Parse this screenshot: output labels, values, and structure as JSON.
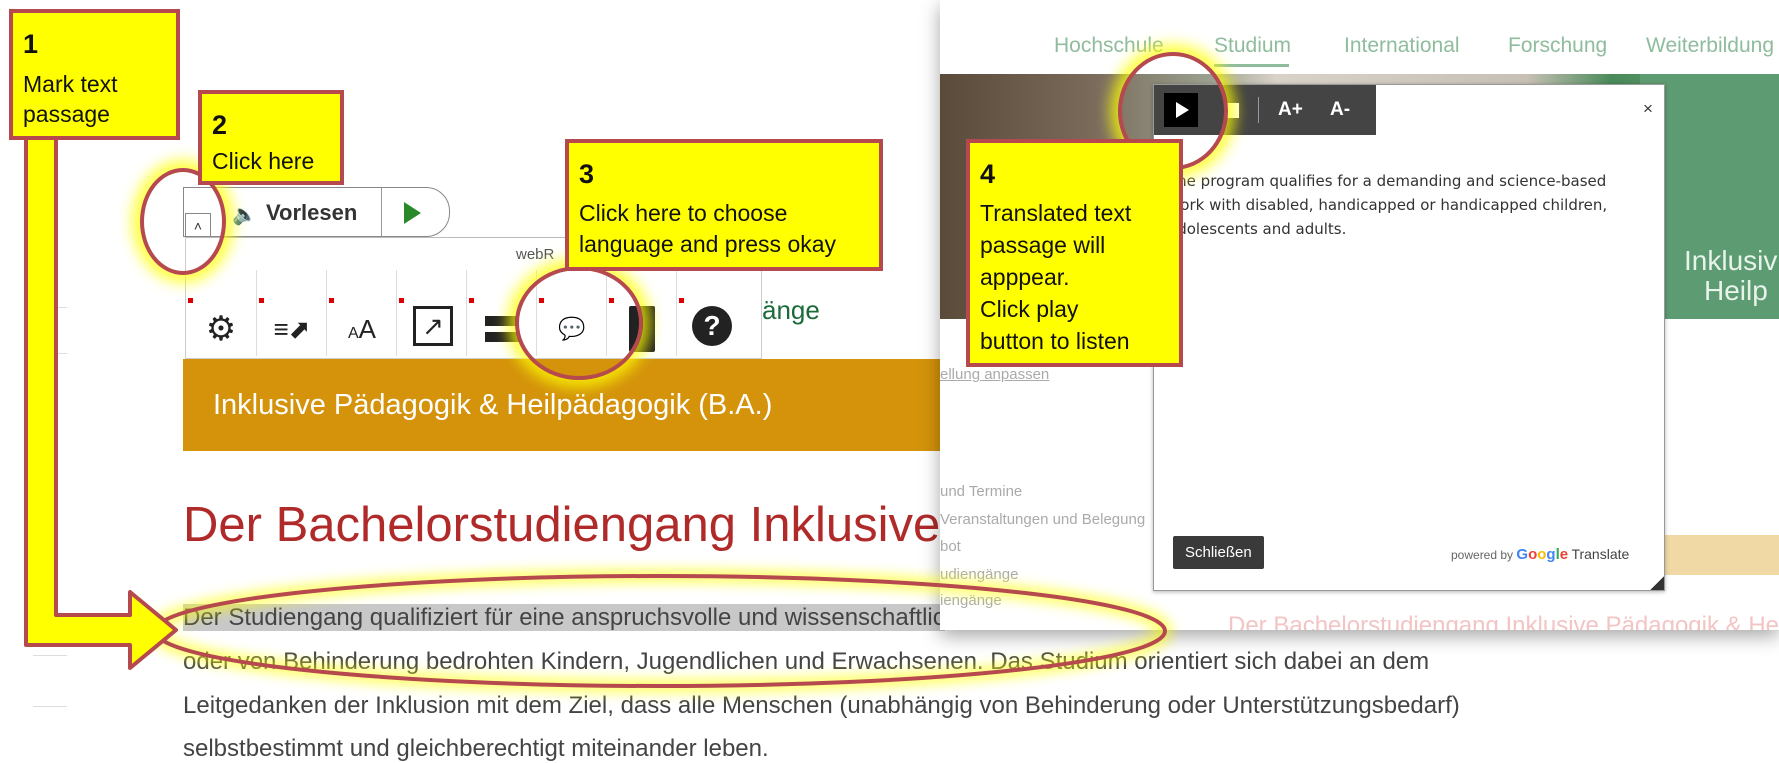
{
  "page": {
    "vorlesen_label": "Vorlesen",
    "webreader_label": "webR",
    "program_banner": "Inklusive Pädagogik & Heilpädagogik (B.A.)",
    "nav_partial": "änge",
    "heading": "Der Bachelorstudiengang Inklusive Päda",
    "paragraph_lines": [
      "Der Studiengang qualifiziert für eine anspruchsvolle und wissenschaftlic",
      "oder von Behinderung bedrohten Kindern, Jugendlichen und Erwachsenen. Das Studium orientiert sich dabei an dem",
      "Leitgedanken der Inklusion mit dem Ziel, dass alle Menschen (unabhängig von Behinderung oder Unterstützungsbedarf)",
      "selbstbestimmt und gleichberechtigt miteinander leben."
    ],
    "toolbar_icons": [
      "gear-icon",
      "select-text-icon",
      "text-size-icon",
      "open-external-icon",
      "screen-mask-icon",
      "translate-icon",
      "dictionary-icon",
      "help-icon"
    ]
  },
  "browser": {
    "nav": [
      "Hochschule",
      "Studium",
      "International",
      "Forschung",
      "Weiterbildung"
    ],
    "hero_text": [
      "Inklusiv",
      "Heilp"
    ],
    "menu_partial": [
      "ellung anpassen",
      "und Termine",
      "Veranstaltungen und Belegung",
      "bot",
      "udiengänge",
      "iengänge"
    ],
    "ghost_heading": "Der Bachelorstudiengang Inklusive Pädagogik & He"
  },
  "translate_dialog": {
    "font_up": "A+",
    "font_down": "A-",
    "close_x": "×",
    "text": "The program qualifies for a demanding and science-based work with disabled, handicapped or handicapped children, adolescents and adults.",
    "close_button": "Schließen",
    "powered_by": "powered by",
    "google": [
      "G",
      "o",
      "o",
      "g",
      "l",
      "e"
    ],
    "translate": "Translate"
  },
  "callouts": [
    {
      "num": "1",
      "lines": [
        "Mark text",
        "passage"
      ]
    },
    {
      "num": "2",
      "lines": [
        "Click here"
      ]
    },
    {
      "num": "3",
      "lines": [
        "Click here to choose",
        "language and press okay"
      ]
    },
    {
      "num": "4",
      "lines": [
        "Translated text",
        "passage will",
        "apppear.",
        "Click play",
        "button to listen"
      ]
    }
  ],
  "colors": {
    "callout_fill": "#ffff00",
    "callout_border": "#b5494d",
    "banner": "#d4930b",
    "heading": "#b02a2a"
  }
}
